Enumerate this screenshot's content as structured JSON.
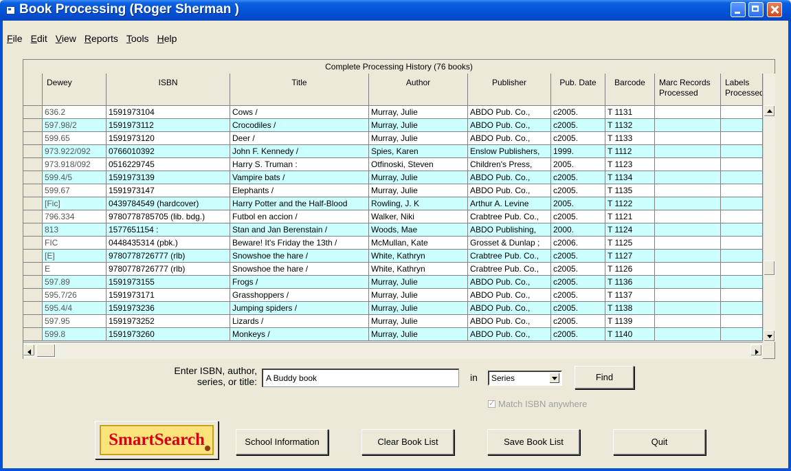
{
  "window": {
    "title": "Book Processing (Roger Sherman )"
  },
  "menu": [
    {
      "pre": "",
      "key": "F",
      "post": "ile"
    },
    {
      "pre": "",
      "key": "E",
      "post": "dit"
    },
    {
      "pre": "",
      "key": "V",
      "post": "iew"
    },
    {
      "pre": "",
      "key": "R",
      "post": "eports"
    },
    {
      "pre": "",
      "key": "T",
      "post": "ools"
    },
    {
      "pre": "",
      "key": "H",
      "post": "elp"
    }
  ],
  "grid": {
    "caption": "Complete Processing History  (76 books)",
    "columns": [
      "",
      "Dewey",
      "ISBN",
      "Title",
      "Author",
      "Publisher",
      "Pub. Date",
      "Barcode",
      "Marc Records Processed",
      "Labels Processed"
    ],
    "rows": [
      [
        "636.2",
        "1591973104",
        "Cows /",
        "Murray, Julie",
        "ABDO Pub. Co.,",
        "c2005.",
        "T 1131",
        "",
        ""
      ],
      [
        "597.98/2",
        "1591973112",
        "Crocodiles /",
        "Murray, Julie",
        "ABDO Pub. Co.,",
        "c2005.",
        "T 1132",
        "",
        ""
      ],
      [
        "599.65",
        "1591973120",
        "Deer /",
        "Murray, Julie",
        "ABDO Pub. Co.,",
        "c2005.",
        "T 1133",
        "",
        ""
      ],
      [
        "973.922/092",
        "0766010392",
        "John F. Kennedy /",
        "Spies, Karen",
        "Enslow Publishers,",
        "1999.",
        "T 1112",
        "",
        ""
      ],
      [
        "973.918/092",
        "0516229745",
        "Harry S. Truman :",
        "Otfinoski, Steven",
        "Children's Press,",
        "2005.",
        "T 1123",
        "",
        ""
      ],
      [
        "599.4/5",
        "1591973139",
        "Vampire bats /",
        "Murray, Julie",
        "ABDO Pub. Co.,",
        "c2005.",
        "T 1134",
        "",
        ""
      ],
      [
        "599.67",
        "1591973147",
        "Elephants /",
        "Murray, Julie",
        "ABDO Pub. Co.,",
        "c2005.",
        "T 1135",
        "",
        ""
      ],
      [
        "[Fic]",
        "0439784549 (hardcover)",
        "Harry Potter and the Half-Blood",
        "Rowling, J. K",
        "Arthur A. Levine",
        "2005.",
        "T 1122",
        "",
        ""
      ],
      [
        "796.334",
        "9780778785705  (lib. bdg.)",
        "Futbol en accion /",
        "Walker, Niki",
        "Crabtree Pub. Co.,",
        "c2005.",
        "T 1121",
        "",
        ""
      ],
      [
        "813",
        "1577651154 :",
        "Stan and Jan Berenstain /",
        "Woods, Mae",
        "ABDO Publishing,",
        "2000.",
        "T 1124",
        "",
        ""
      ],
      [
        "FIC",
        "0448435314  (pbk.)",
        "Beware! It's Friday the 13th /",
        "McMullan, Kate",
        "Grosset & Dunlap ;",
        "c2006.",
        "T 1125",
        "",
        ""
      ],
      [
        "[E]",
        "9780778726777  (rlb)",
        "Snowshoe the hare /",
        "White, Kathryn",
        "Crabtree Pub. Co.,",
        "c2005.",
        "T 1127",
        "",
        ""
      ],
      [
        "E",
        "9780778726777  (rlb)",
        "Snowshoe the hare /",
        "White, Kathryn",
        "Crabtree Pub. Co.,",
        "c2005.",
        "T 1126",
        "",
        ""
      ],
      [
        "597.89",
        "1591973155",
        "Frogs /",
        "Murray, Julie",
        "ABDO Pub. Co.,",
        "c2005.",
        "T 1136",
        "",
        ""
      ],
      [
        "595.7/26",
        "1591973171",
        "Grasshoppers /",
        "Murray, Julie",
        "ABDO Pub. Co.,",
        "c2005.",
        "T 1137",
        "",
        ""
      ],
      [
        "595.4/4",
        "1591973236",
        "Jumping spiders /",
        "Murray, Julie",
        "ABDO Pub. Co.,",
        "c2005.",
        "T 1138",
        "",
        ""
      ],
      [
        "597.95",
        "1591973252",
        "Lizards /",
        "Murray, Julie",
        "ABDO Pub. Co.,",
        "c2005.",
        "T 1139",
        "",
        ""
      ],
      [
        "599.8",
        "1591973260",
        "Monkeys /",
        "Murray, Julie",
        "ABDO Pub. Co.,",
        "c2005.",
        "T 1140",
        "",
        ""
      ]
    ]
  },
  "search": {
    "label_line1": "Enter ISBN, author,",
    "label_line2": "series, or title:",
    "value": "A Buddy book",
    "in_label": "in",
    "field_selected": "Series",
    "find_label": "Find",
    "match_label": "Match ISBN anywhere"
  },
  "buttons": {
    "smartsearch": "SmartSearch",
    "school_info": "School Information",
    "clear": "Clear Book List",
    "save": "Save Book List",
    "quit": "Quit"
  },
  "colors": {
    "alt_row": "#ccffff",
    "title_bar": "#0352d6",
    "smartsearch_bg": "#fbe27a",
    "smartsearch_text": "#d4001a"
  }
}
